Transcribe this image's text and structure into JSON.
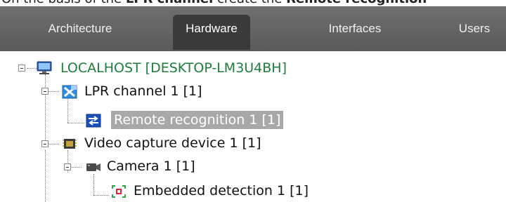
{
  "caption": {
    "prefix": "On the basis of the ",
    "bold1": "LPR channel",
    "middle": " create the ",
    "bold2": "Remote recognition"
  },
  "tabs": [
    {
      "label": "Architecture",
      "active": false
    },
    {
      "label": "Hardware",
      "active": true
    },
    {
      "label": "Interfaces",
      "active": false
    },
    {
      "label": "Users",
      "active": false
    }
  ],
  "tree": {
    "root": {
      "label": "LOCALHOST [DESKTOP-LM3U4BH]",
      "icon": "computer-icon"
    },
    "lpr_channel": {
      "label": "LPR channel  1 [1]",
      "icon": "lpr-channel-icon"
    },
    "remote_recognition": {
      "label": "Remote recognition 1 [1]",
      "icon": "remote-recognition-icon",
      "selected": true
    },
    "video_capture": {
      "label": "Video capture device 1 [1]",
      "icon": "video-capture-board-icon"
    },
    "camera": {
      "label": "Camera 1 [1]",
      "icon": "camera-icon"
    },
    "embedded_detection": {
      "label": "Embedded detection 1 [1]",
      "icon": "embedded-detection-icon"
    }
  },
  "colors": {
    "tabbar": "#636363",
    "active_tab": "#3a3a3a",
    "root_label": "#1c7f3a",
    "selection": "#a8a8a8"
  }
}
